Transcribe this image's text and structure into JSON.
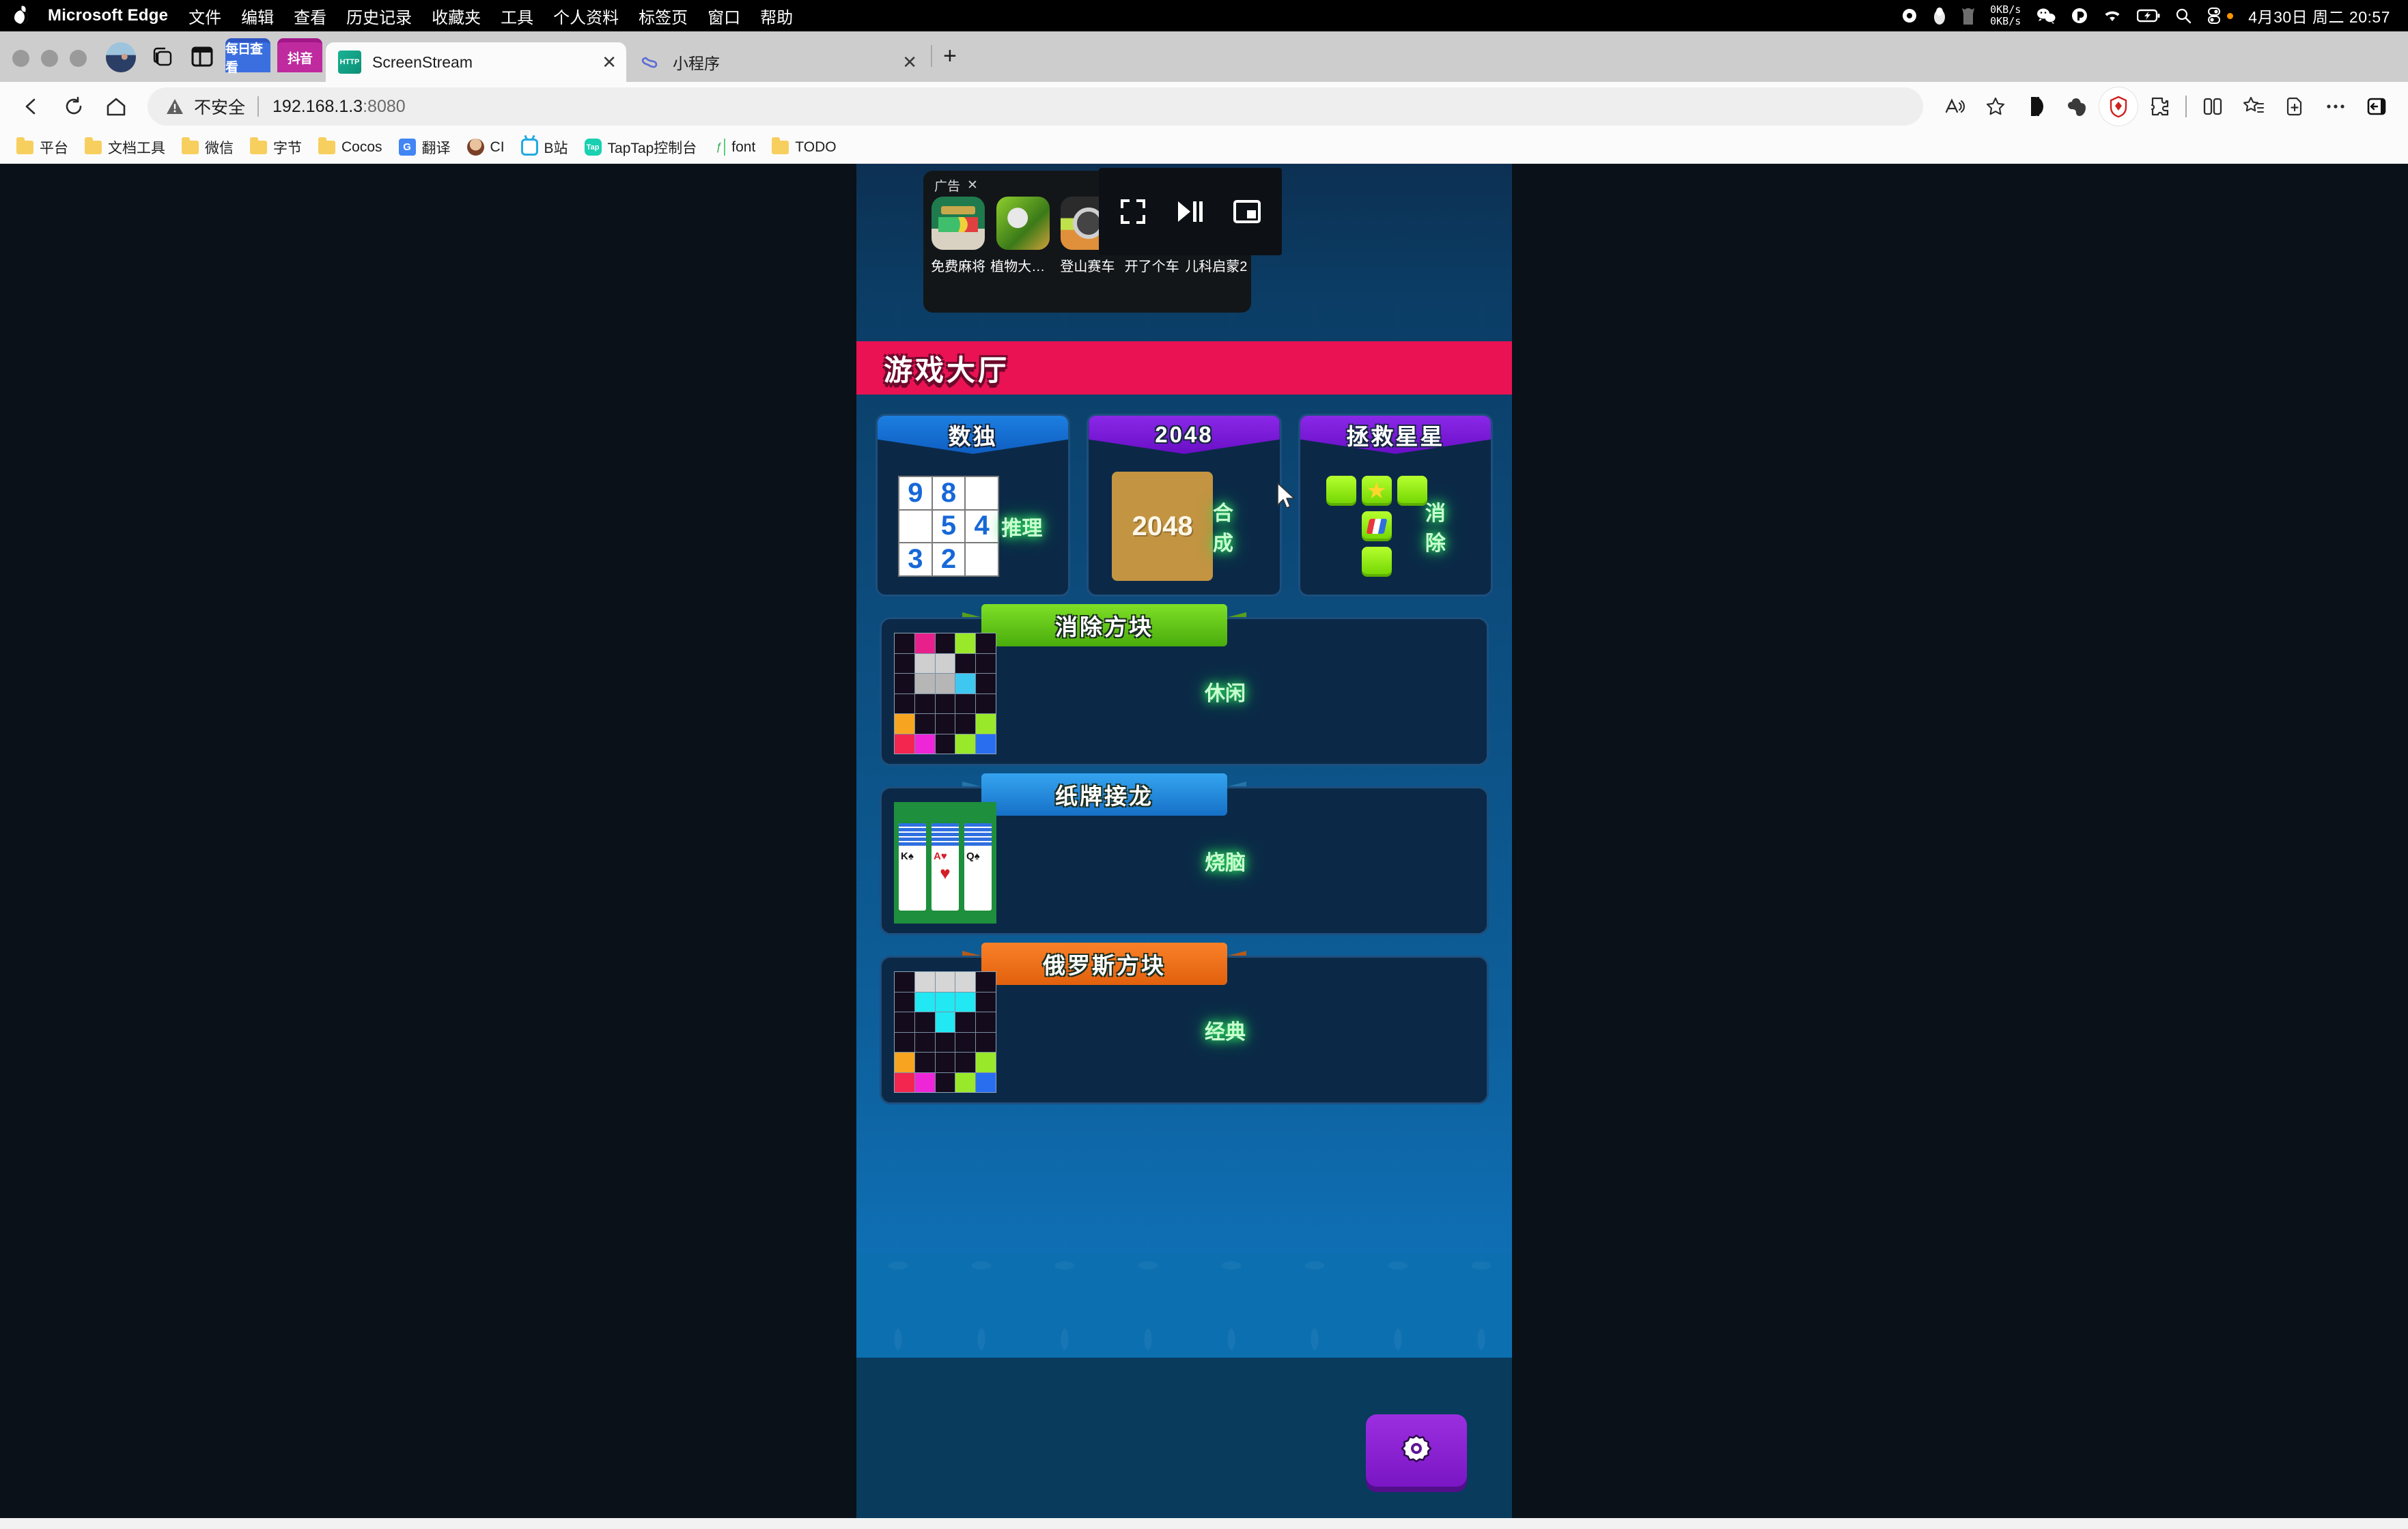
{
  "macbar": {
    "app_name": "Microsoft Edge",
    "menus": [
      "文件",
      "编辑",
      "查看",
      "历史记录",
      "收藏夹",
      "工具",
      "个人资料",
      "标签页",
      "窗口",
      "帮助"
    ],
    "status_icons": [
      "record-icon",
      "penguin-icon",
      "cat-icon"
    ],
    "net_speed_up": "0KB/s",
    "net_speed_down": "0KB/s",
    "tray_icons": [
      "wechat-icon",
      "app-icon",
      "wifi-icon",
      "battery-charging-icon",
      "search-icon",
      "control-center-icon"
    ],
    "date": "4月30日 周二 20:57"
  },
  "tabs": {
    "pinned": [
      {
        "label": "每日查看"
      },
      {
        "label": "抖音"
      }
    ],
    "items": [
      {
        "label": "ScreenStream",
        "favicon": "HTTP",
        "active": true,
        "close": "✕"
      },
      {
        "label": "小程序",
        "favicon": "mini-program",
        "active": false,
        "close": "✕"
      }
    ],
    "new_tab": "+"
  },
  "toolbar": {
    "back": "back-icon",
    "reload": "reload-icon",
    "home": "home-icon",
    "security_label": "不安全",
    "url_host": "192.168.1.3",
    "url_port": ":8080",
    "url_full": "192.168.1.3:8080",
    "right_icons": [
      "read-aloud-icon",
      "favorite-star-icon",
      "extension-v-icon",
      "evernote-icon",
      "shield-extension-icon",
      "puzzle-icon",
      "split-screen-icon",
      "collections-icon",
      "add-collection-icon",
      "more-icon",
      "sidebar-toggle-icon"
    ]
  },
  "bookmarks": [
    {
      "label": "平台",
      "icon": "folder-icon"
    },
    {
      "label": "文档工具",
      "icon": "folder-icon"
    },
    {
      "label": "微信",
      "icon": "folder-icon"
    },
    {
      "label": "字节",
      "icon": "folder-icon"
    },
    {
      "label": "Cocos",
      "icon": "folder-icon"
    },
    {
      "label": "翻译",
      "icon": "google-translate-icon"
    },
    {
      "label": "CI",
      "icon": "avatar-icon"
    },
    {
      "label": "B站",
      "icon": "bilibili-icon"
    },
    {
      "label": "TapTap控制台",
      "icon": "taptap-icon"
    },
    {
      "label": "font",
      "icon": "font-icon"
    },
    {
      "label": "TODO",
      "icon": "folder-icon"
    }
  ],
  "page": {
    "ad": {
      "label": "广告",
      "close": "✕",
      "items": [
        {
          "name": "免费麻将",
          "thumb": "mahjong-thumb"
        },
        {
          "name": "植物大战...",
          "thumb": "pvz-thumb"
        },
        {
          "name": "登山赛车",
          "thumb": "hill-climb-thumb"
        },
        {
          "name": "开了个车",
          "thumb": "car-thumb"
        },
        {
          "name": "儿科启蒙2",
          "thumb": "kids-thumb"
        }
      ]
    },
    "media_controls": [
      "fullscreen-icon",
      "play-pause-icon",
      "picture-in-picture-icon"
    ],
    "lobby_title": "游戏大厅",
    "top_games": [
      {
        "title": "数独",
        "tag": "推理",
        "ribbon_color": "#1c7fe0",
        "sudoku": [
          "9",
          "8",
          "",
          "",
          "5",
          "4",
          "3",
          "2",
          ""
        ]
      },
      {
        "title": "2048",
        "tag": "合成",
        "ribbon_color": "#8a28e8",
        "tile_value": "2048"
      },
      {
        "title": "拯救星星",
        "tag": "消除",
        "ribbon_color": "#8a28e8"
      }
    ],
    "wide_games": [
      {
        "title": "消除方块",
        "tag": "休闲",
        "ribbon_color": "#7ee026",
        "thumb": "blocks-grid-thumb"
      },
      {
        "title": "纸牌接龙",
        "tag": "烧脑",
        "ribbon_color": "#35a4ef",
        "thumb": "solitaire-thumb",
        "cards": [
          {
            "rank": "K",
            "suit": "♠",
            "color": "blk"
          },
          {
            "rank": "A",
            "suit": "♥",
            "color": "red"
          },
          {
            "rank": "Q",
            "suit": "♠",
            "color": "blk"
          }
        ]
      },
      {
        "title": "俄罗斯方块",
        "tag": "经典",
        "ribbon_color": "#f98128",
        "thumb": "tetris-thumb"
      }
    ],
    "settings_button": "gear-icon"
  }
}
